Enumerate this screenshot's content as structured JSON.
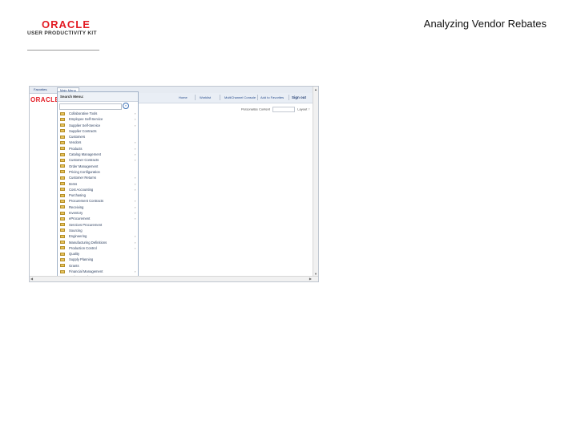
{
  "document": {
    "title": "Analyzing Vendor Rebates",
    "logo": {
      "brand": "ORACLE",
      "product": "USER PRODUCTIVITY KIT"
    }
  },
  "screenshot": {
    "tabs": {
      "favorites": "Favorites",
      "main_menu": "Main Menu"
    },
    "brand": "ORACLE",
    "header_links": [
      "Home",
      "Worklist",
      "MultiChannel Console",
      "Add to Favorites",
      "Sign out"
    ],
    "personalize": {
      "label": "Personalize Content",
      "layout": "Layout"
    },
    "menu": {
      "title": "Search Menu:",
      "items": [
        {
          "label": "Collaborative Tools",
          "has_children": true
        },
        {
          "label": "Employee Self-Service",
          "has_children": true
        },
        {
          "label": "Supplier Self-Service",
          "has_children": true
        },
        {
          "label": "Supplier Contracts",
          "has_children": false
        },
        {
          "label": "Customers",
          "has_children": false
        },
        {
          "label": "Vendors",
          "has_children": true
        },
        {
          "label": "Products",
          "has_children": true
        },
        {
          "label": "Catalog Management",
          "has_children": true
        },
        {
          "label": "Customer Contracts",
          "has_children": true
        },
        {
          "label": "Order Management",
          "has_children": false
        },
        {
          "label": "Pricing Configuration",
          "has_children": false
        },
        {
          "label": "Customer Returns",
          "has_children": true
        },
        {
          "label": "Items",
          "has_children": true
        },
        {
          "label": "Cost Accounting",
          "has_children": true
        },
        {
          "label": "Purchasing",
          "has_children": false
        },
        {
          "label": "Procurement Contracts",
          "has_children": true
        },
        {
          "label": "Receiving",
          "has_children": true
        },
        {
          "label": "Inventory",
          "has_children": true
        },
        {
          "label": "eProcurement",
          "has_children": true
        },
        {
          "label": "Services Procurement",
          "has_children": false
        },
        {
          "label": "Sourcing",
          "has_children": false
        },
        {
          "label": "Engineering",
          "has_children": true
        },
        {
          "label": "Manufacturing Definitions",
          "has_children": true
        },
        {
          "label": "Production Control",
          "has_children": true
        },
        {
          "label": "Quality",
          "has_children": false
        },
        {
          "label": "Supply Planning",
          "has_children": false
        },
        {
          "label": "Grants",
          "has_children": false
        },
        {
          "label": "Financial Management",
          "has_children": true
        },
        {
          "label": "Project Costing",
          "has_children": true
        }
      ]
    }
  }
}
